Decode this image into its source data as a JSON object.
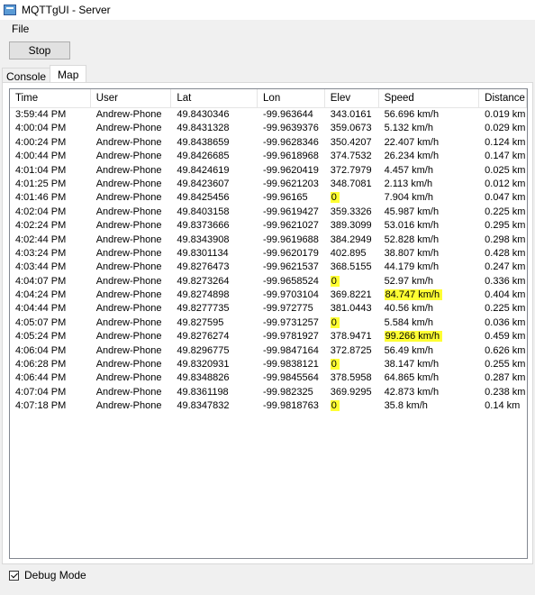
{
  "window": {
    "title": "MQTTgUI - Server",
    "icon": "app-window-icon"
  },
  "menu": {
    "items": [
      {
        "label": "File"
      }
    ]
  },
  "toolbar": {
    "stop_label": "Stop"
  },
  "tabs": [
    {
      "label": "Console",
      "active": false
    },
    {
      "label": "Map",
      "active": true
    }
  ],
  "table": {
    "columns": [
      "Time",
      "User",
      "Lat",
      "Lon",
      "Elev",
      "Speed",
      "Distance"
    ],
    "rows": [
      [
        "3:59:44 PM",
        "Andrew-Phone",
        "49.8430346",
        "-99.963644",
        "343.0161",
        "56.696 km/h",
        "0.019 km"
      ],
      [
        "4:00:04 PM",
        "Andrew-Phone",
        "49.8431328",
        "-99.9639376",
        "359.0673",
        "5.132 km/h",
        "0.029 km"
      ],
      [
        "4:00:24 PM",
        "Andrew-Phone",
        "49.8438659",
        "-99.9628346",
        "350.4207",
        "22.407 km/h",
        "0.124 km"
      ],
      [
        "4:00:44 PM",
        "Andrew-Phone",
        "49.8426685",
        "-99.9618968",
        "374.7532",
        "26.234 km/h",
        "0.147 km"
      ],
      [
        "4:01:04 PM",
        "Andrew-Phone",
        "49.8424619",
        "-99.9620419",
        "372.7979",
        "4.457 km/h",
        "0.025 km"
      ],
      [
        "4:01:25 PM",
        "Andrew-Phone",
        "49.8423607",
        "-99.9621203",
        "348.7081",
        "2.113 km/h",
        "0.012 km"
      ],
      [
        "4:01:46 PM",
        "Andrew-Phone",
        "49.8425456",
        "-99.96165",
        "0",
        "7.904 km/h",
        "0.047 km"
      ],
      [
        "4:02:04 PM",
        "Andrew-Phone",
        "49.8403158",
        "-99.9619427",
        "359.3326",
        "45.987 km/h",
        "0.225 km"
      ],
      [
        "4:02:24 PM",
        "Andrew-Phone",
        "49.8373666",
        "-99.9621027",
        "389.3099",
        "53.016 km/h",
        "0.295 km"
      ],
      [
        "4:02:44 PM",
        "Andrew-Phone",
        "49.8343908",
        "-99.9619688",
        "384.2949",
        "52.828 km/h",
        "0.298 km"
      ],
      [
        "4:03:24 PM",
        "Andrew-Phone",
        "49.8301134",
        "-99.9620179",
        "402.895",
        "38.807 km/h",
        "0.428 km"
      ],
      [
        "4:03:44 PM",
        "Andrew-Phone",
        "49.8276473",
        "-99.9621537",
        "368.5155",
        "44.179 km/h",
        "0.247 km"
      ],
      [
        "4:04:07 PM",
        "Andrew-Phone",
        "49.8273264",
        "-99.9658524",
        "0",
        "52.97 km/h",
        "0.336 km"
      ],
      [
        "4:04:24 PM",
        "Andrew-Phone",
        "49.8274898",
        "-99.9703104",
        "369.8221",
        "84.747 km/h",
        "0.404 km"
      ],
      [
        "4:04:44 PM",
        "Andrew-Phone",
        "49.8277735",
        "-99.972775",
        "381.0443",
        "40.56 km/h",
        "0.225 km"
      ],
      [
        "4:05:07 PM",
        "Andrew-Phone",
        "49.827595",
        "-99.9731257",
        "0",
        "5.584 km/h",
        "0.036 km"
      ],
      [
        "4:05:24 PM",
        "Andrew-Phone",
        "49.8276274",
        "-99.9781927",
        "378.9471",
        "99.266 km/h",
        "0.459 km"
      ],
      [
        "4:06:04 PM",
        "Andrew-Phone",
        "49.8296775",
        "-99.9847164",
        "372.8725",
        "56.49 km/h",
        "0.626 km"
      ],
      [
        "4:06:28 PM",
        "Andrew-Phone",
        "49.8320931",
        "-99.9838121",
        "0",
        "38.147 km/h",
        "0.255 km"
      ],
      [
        "4:06:44 PM",
        "Andrew-Phone",
        "49.8348826",
        "-99.9845564",
        "378.5958",
        "64.865 km/h",
        "0.287 km"
      ],
      [
        "4:07:04 PM",
        "Andrew-Phone",
        "49.8361198",
        "-99.982325",
        "369.9295",
        "42.873 km/h",
        "0.238 km"
      ],
      [
        "4:07:18 PM",
        "Andrew-Phone",
        "49.8347832",
        "-99.9818763",
        "0",
        "35.8 km/h",
        "0.14 km"
      ]
    ],
    "highlights": [
      {
        "row": 6,
        "col": 4
      },
      {
        "row": 12,
        "col": 4
      },
      {
        "row": 13,
        "col": 5
      },
      {
        "row": 15,
        "col": 4
      },
      {
        "row": 16,
        "col": 5
      },
      {
        "row": 18,
        "col": 4
      },
      {
        "row": 21,
        "col": 4
      }
    ],
    "highlight_color": "#ffff33"
  },
  "debug": {
    "label": "Debug Mode",
    "checked": true
  }
}
